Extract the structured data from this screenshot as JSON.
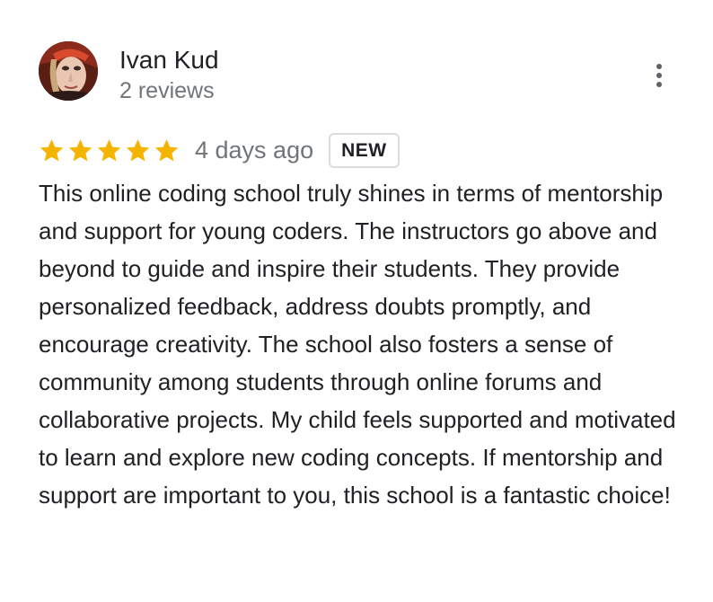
{
  "reviewer": {
    "name": "Ivan Kud",
    "reviews_count": "2 reviews",
    "avatar_icon": "user-avatar-photo"
  },
  "menu": {
    "icon": "more-vert-icon"
  },
  "rating": {
    "stars": 5,
    "max_stars": 5,
    "star_color": "#f4b400",
    "date": "4 days ago",
    "badge": "NEW"
  },
  "review": {
    "text": "This online coding school truly shines in terms of mentorship and support for young coders. The instructors go above and beyond to guide and inspire their students. They provide personalized feedback, address doubts promptly, and encourage creativity. The school also fosters a sense of community among students through online forums and collaborative projects. My child feels supported and motivated to learn and explore new coding concepts. If mentorship and support are important to you, this school is a fantastic choice!"
  }
}
